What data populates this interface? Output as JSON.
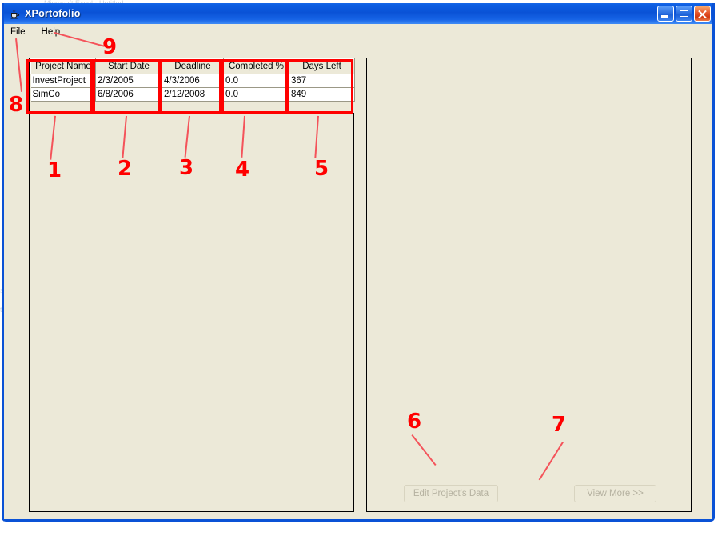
{
  "window": {
    "title": "XPortofolio",
    "icon": "java-coffee-cup-icon",
    "controls": {
      "minimize": "minimize-button",
      "maximize": "maximize-button",
      "close": "close-button"
    },
    "colors": {
      "titlebar_blue": "#0a52d6",
      "client_beige": "#ece9d8",
      "close_red": "#e5532a",
      "annotation_red": "#ff0000"
    }
  },
  "menubar": {
    "items": [
      {
        "label": "File"
      },
      {
        "label": "Help"
      }
    ]
  },
  "table": {
    "columns": [
      {
        "label": "Project Name"
      },
      {
        "label": "Start Date"
      },
      {
        "label": "Deadline"
      },
      {
        "label": "Completed %"
      },
      {
        "label": "Days Left"
      }
    ],
    "rows": [
      {
        "project_name": "InvestProject",
        "start_date": "2/3/2005",
        "deadline": "4/3/2006",
        "completed_pct": "0.0",
        "days_left": "367"
      },
      {
        "project_name": "SimCo",
        "start_date": "6/8/2006",
        "deadline": "2/12/2008",
        "completed_pct": "0.0",
        "days_left": "849"
      }
    ]
  },
  "buttons": {
    "edit": {
      "label": "Edit Project's Data",
      "state": "disabled"
    },
    "view_more": {
      "label": "View More >>",
      "state": "disabled"
    }
  },
  "annotations": {
    "markers": [
      {
        "id": "1",
        "target": "column-project-name"
      },
      {
        "id": "2",
        "target": "column-start-date"
      },
      {
        "id": "3",
        "target": "column-deadline"
      },
      {
        "id": "4",
        "target": "column-completed-pct"
      },
      {
        "id": "5",
        "target": "column-days-left"
      },
      {
        "id": "6",
        "target": "edit-project-data-button"
      },
      {
        "id": "7",
        "target": "view-more-button"
      },
      {
        "id": "8",
        "target": "file-menu"
      },
      {
        "id": "9",
        "target": "help-menu"
      }
    ]
  },
  "backdrop": {
    "strips": [
      {
        "text": "Microsoft Excel - Untitled"
      }
    ]
  }
}
